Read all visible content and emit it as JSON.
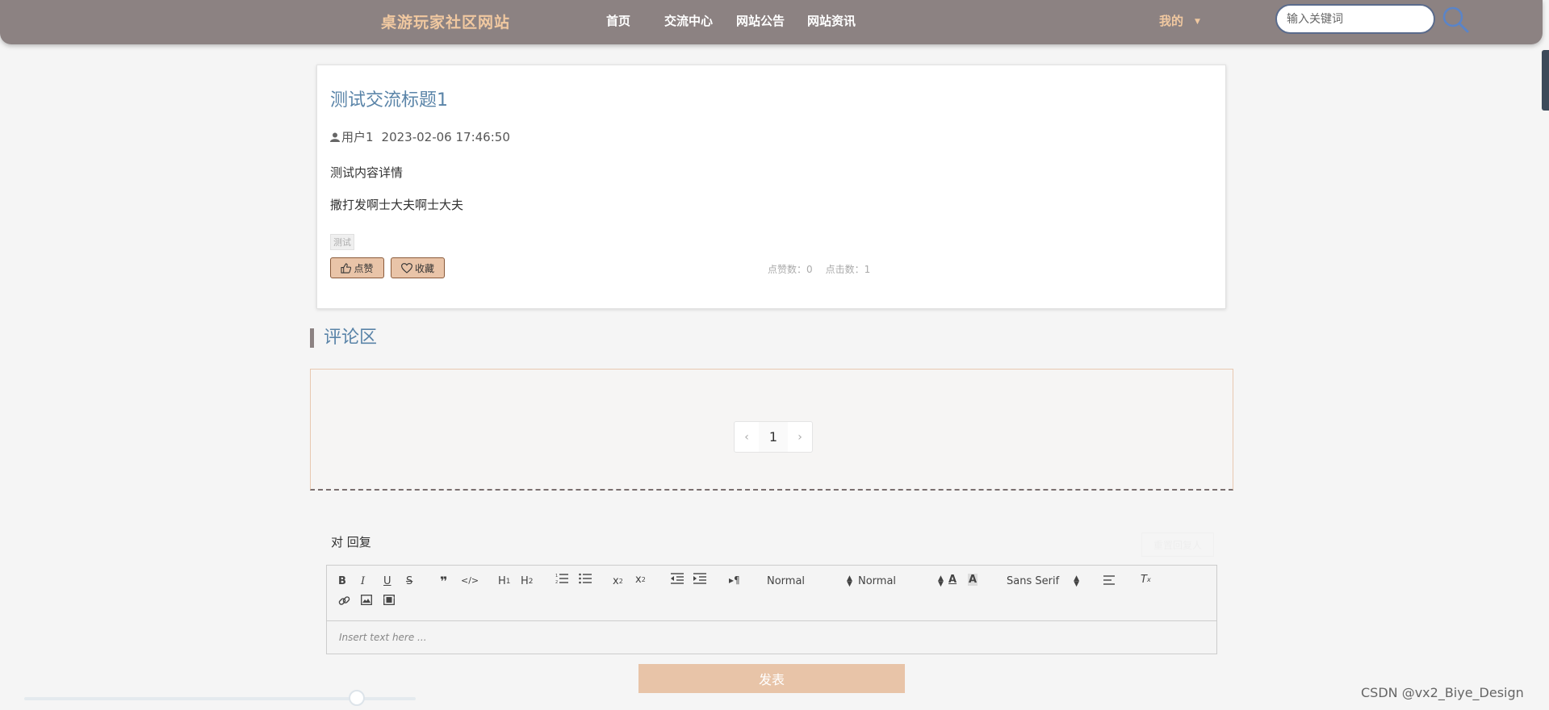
{
  "header": {
    "brand": "桌游玩家社区网站",
    "nav": [
      "首页",
      "交流中心",
      "网站公告",
      "网站资讯"
    ],
    "user_menu": "我的",
    "search_placeholder": "输入关键词"
  },
  "post": {
    "title": "测试交流标题1",
    "author": "用户1",
    "date": "2023-02-06 17:46:50",
    "content": [
      "测试内容详情",
      "撒打发啊士大夫啊士大夫"
    ],
    "tag": "测试",
    "like_label": "点赞",
    "favorite_label": "收藏",
    "like_count_text": "点赞数：0",
    "click_count_text": "点击数：1"
  },
  "comments": {
    "title": "评论区",
    "pagination": {
      "prev": "‹",
      "current": "1",
      "next": "›"
    }
  },
  "reply": {
    "label": "对 回复",
    "reset_label": "重置回复人",
    "toolbar": {
      "header_select": "Normal",
      "size_select": "Normal",
      "font_select": "Sans Serif"
    },
    "placeholder": "Insert text here ...",
    "submit_label": "发表"
  },
  "slider": {
    "value": 0.85
  },
  "watermark": "CSDN @vx2_Biye_Design"
}
